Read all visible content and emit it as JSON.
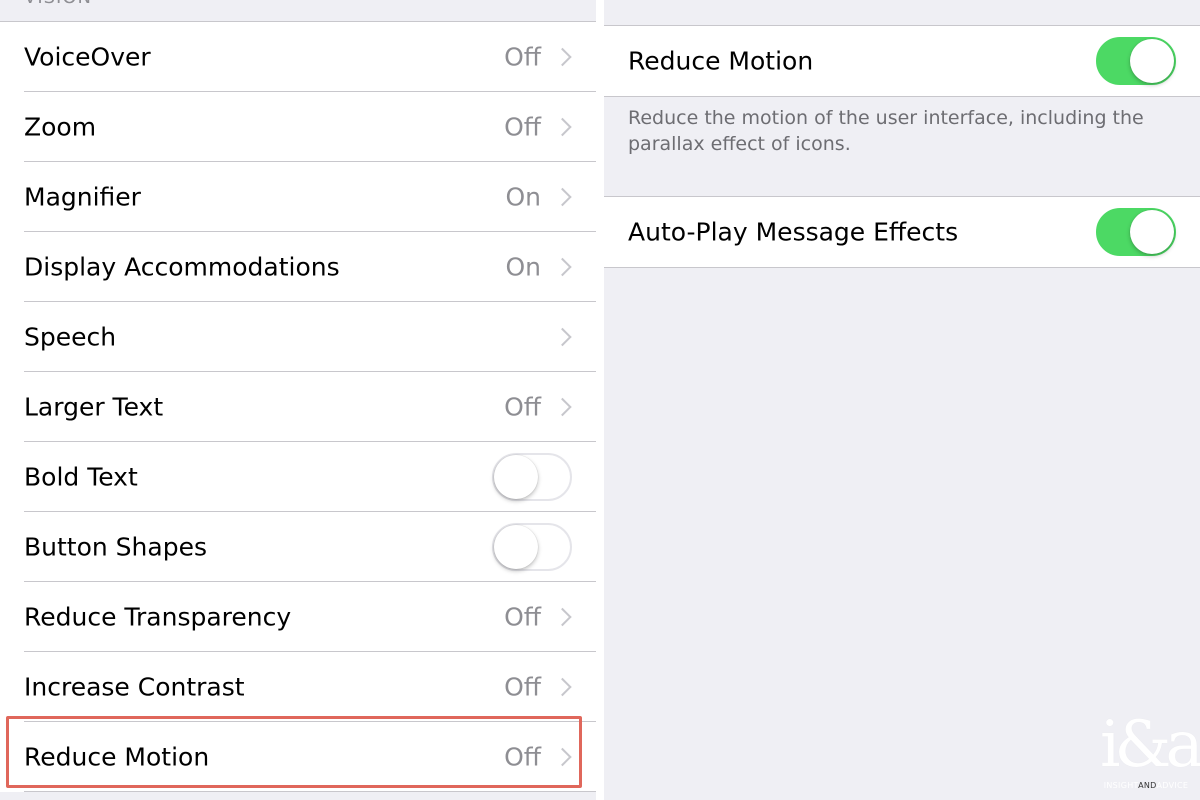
{
  "left": {
    "section_header": "VISION",
    "rows": [
      {
        "label": "VoiceOver",
        "value": "Off",
        "type": "disclosure"
      },
      {
        "label": "Zoom",
        "value": "Off",
        "type": "disclosure"
      },
      {
        "label": "Magnifier",
        "value": "On",
        "type": "disclosure"
      },
      {
        "label": "Display Accommodations",
        "value": "On",
        "type": "disclosure"
      },
      {
        "label": "Speech",
        "value": "",
        "type": "disclosure"
      },
      {
        "label": "Larger Text",
        "value": "Off",
        "type": "disclosure"
      },
      {
        "label": "Bold Text",
        "value": "",
        "type": "toggle",
        "on": false
      },
      {
        "label": "Button Shapes",
        "value": "",
        "type": "toggle",
        "on": false
      },
      {
        "label": "Reduce Transparency",
        "value": "Off",
        "type": "disclosure"
      },
      {
        "label": "Increase Contrast",
        "value": "Off",
        "type": "disclosure"
      },
      {
        "label": "Reduce Motion",
        "value": "Off",
        "type": "disclosure",
        "highlighted": true
      }
    ]
  },
  "right": {
    "reduce_motion": {
      "label": "Reduce Motion",
      "on": true
    },
    "reduce_motion_footer": "Reduce the motion of the user interface, including the parallax effect of icons.",
    "auto_play": {
      "label": "Auto-Play Message Effects",
      "on": true
    }
  },
  "logo": {
    "mark": "i&a",
    "sub_left": "INSIGHT",
    "sub_and": "AND",
    "sub_right": "ADVICE"
  },
  "colors": {
    "toggle_on": "#4cd964",
    "highlight": "#e0675b",
    "background": "#efeff4",
    "secondary_text": "#8e8e93"
  }
}
